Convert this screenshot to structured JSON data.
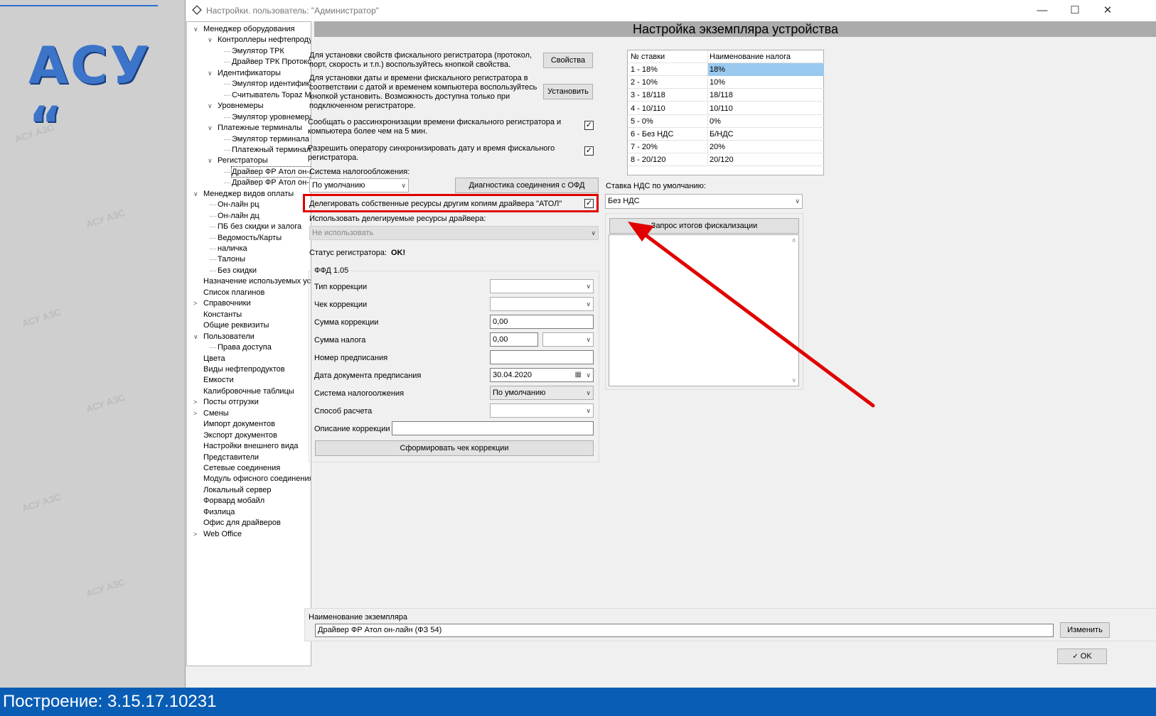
{
  "background": {
    "logo": "АСУ “",
    "watermark": "АСУ АЗС",
    "build_label": "Построение: 3.15.17.10231"
  },
  "window": {
    "title": "Настройки. пользователь: \"Администратор\"",
    "minimize": "—",
    "maximize": "☐",
    "close": "✕"
  },
  "tree": [
    {
      "label": "Менеджер оборудования",
      "level": 0,
      "exp": "v"
    },
    {
      "label": "Контроллеры нефтепродуктов",
      "level": 1,
      "exp": "v"
    },
    {
      "label": "Эмулятор ТРК",
      "level": 2
    },
    {
      "label": "Драйвер ТРК Протокол",
      "level": 2
    },
    {
      "label": "Идентификаторы",
      "level": 1,
      "exp": "v"
    },
    {
      "label": "Эмулятор идентификатора",
      "level": 2
    },
    {
      "label": "Считыватель Topaz M",
      "level": 2
    },
    {
      "label": "Уровнемеры",
      "level": 1,
      "exp": "v"
    },
    {
      "label": "Эмулятор уровнемера",
      "level": 2
    },
    {
      "label": "Платежные терминалы",
      "level": 1,
      "exp": "v"
    },
    {
      "label": "Эмулятор терминала",
      "level": 2
    },
    {
      "label": "Платежный терминал",
      "level": 2
    },
    {
      "label": "Регистраторы",
      "level": 1,
      "exp": "v"
    },
    {
      "label": "Драйвер ФР Атол он-лайн",
      "level": 2,
      "selected": true
    },
    {
      "label": "Драйвер ФР Атол он-лайн",
      "level": 2
    },
    {
      "label": "Менеджер видов оплаты",
      "level": 0,
      "exp": "v"
    },
    {
      "label": "Он-лайн рц",
      "level": 1
    },
    {
      "label": "Он-лайн дц",
      "level": 1
    },
    {
      "label": "ПБ без скидки и залога",
      "level": 1
    },
    {
      "label": "Ведомость/Карты",
      "level": 1
    },
    {
      "label": "наличка",
      "level": 1
    },
    {
      "label": "Талоны",
      "level": 1
    },
    {
      "label": "Без скидки",
      "level": 1
    },
    {
      "label": "Назначение используемых устройств",
      "level": 0
    },
    {
      "label": "Список плагинов",
      "level": 0
    },
    {
      "label": "Справочники",
      "level": 0,
      "exp": ">"
    },
    {
      "label": "Константы",
      "level": 0
    },
    {
      "label": "Общие реквизиты",
      "level": 0
    },
    {
      "label": "Пользователи",
      "level": 0,
      "exp": "v"
    },
    {
      "label": "Права доступа",
      "level": 1
    },
    {
      "label": "Цвета",
      "level": 0
    },
    {
      "label": "Виды нефтепродуктов",
      "level": 0
    },
    {
      "label": "Емкости",
      "level": 0
    },
    {
      "label": "Калибровочные таблицы",
      "level": 0
    },
    {
      "label": "Посты отгрузки",
      "level": 0,
      "exp": ">"
    },
    {
      "label": "Смены",
      "level": 0,
      "exp": ">"
    },
    {
      "label": "Импорт документов",
      "level": 0
    },
    {
      "label": "Экспорт документов",
      "level": 0
    },
    {
      "label": "Настройки внешнего вида",
      "level": 0
    },
    {
      "label": "Представители",
      "level": 0
    },
    {
      "label": "Сетевые соединения",
      "level": 0
    },
    {
      "label": "Модуль офисного соединения",
      "level": 0
    },
    {
      "label": "Локальный сервер",
      "level": 0
    },
    {
      "label": "Форвард мобайл",
      "level": 0
    },
    {
      "label": "Физлица",
      "level": 0
    },
    {
      "label": "Офис для драйверов",
      "level": 0
    },
    {
      "label": "Web Office",
      "level": 0,
      "exp": ">"
    }
  ],
  "main": {
    "header": "Настройка экземпляра устройства",
    "props_text1": "Для установки свойств фискального регистратора (протокол,",
    "props_text2": "порт, скорость и т.п.) воспользуйтесь кнопкой  свойства.",
    "props_button": "Свойства",
    "time_text1": "Для установки даты и времени фискального регистратора в",
    "time_text2": "соответствии с датой и временем компьютера воспользуйтесь",
    "time_text3": "кнопкой установить. Возможность доступна только при",
    "time_text4": "подключенном регистраторе.",
    "set_button": "Установить",
    "desync_text1": "Сообщать о рассинхронизации времени фискального регистратора и",
    "desync_text2": "компьютера более чем на 5 мин.",
    "desync_checked": "✓",
    "allow_sync_text1": "Разрешить оператору синхронизировать дату и время фискального",
    "allow_sync_text2": "регистратора.",
    "allow_sync_checked": "✓",
    "tax_system_label": "Система налогообложения:",
    "tax_system_value": "По умолчанию",
    "ofd_diag_button": "Диагностика соединения с ОФД",
    "delegate_text": "Делегировать собственные ресурсы другим копиям драйвера \"АТОЛ\"",
    "delegate_checked": "✓",
    "use_delegated_label": "Использовать делегируемые ресурсы драйвера:",
    "use_delegated_value": "Не использовать",
    "status_label": "Статус регистратора:",
    "status_value": "OK!",
    "ffd": {
      "title": "ФФД 1.05",
      "correction_type_label": "Тип коррекции",
      "correction_check_label": "Чек коррекции",
      "correction_sum_label": "Сумма коррекции",
      "correction_sum_value": "0,00",
      "tax_sum_label": "Сумма налога",
      "tax_sum_value": "0,00",
      "prescription_no_label": "Номер предписания",
      "prescription_date_label": "Дата документа предписания",
      "prescription_date_value": "30.04.2020",
      "tax_system_label": "Система налогоолжения",
      "tax_system_value": "По умолчанию",
      "payment_method_label": "Способ расчета",
      "correction_desc_label": "Описание коррекции",
      "make_check_button": "Сформировать чек коррекции"
    },
    "rates_table": {
      "headers": [
        "№ ставки",
        "Наименование налога"
      ],
      "rows": [
        [
          "1 - 18%",
          "18%"
        ],
        [
          "2 - 10%",
          "10%"
        ],
        [
          "3 - 18/118",
          "18/118"
        ],
        [
          "4 - 10/110",
          "10/110"
        ],
        [
          "5 - 0%",
          "0%"
        ],
        [
          "6 - Без НДС",
          "Б/НДС"
        ],
        [
          "7 - 20%",
          "20%"
        ],
        [
          "8 - 20/120",
          "20/120"
        ]
      ]
    },
    "vat_default_label": "Ставка НДС по умолчанию:",
    "vat_default_value": "Без НДС",
    "fiscal_query_button": "Запрос итогов фискализации",
    "instance_name_label": "Наименование экземпляра",
    "instance_name_value": "Драйвер ФР Атол он-лайн (ФЗ 54)",
    "change_button": "Изменить",
    "ok_button": "OK"
  }
}
